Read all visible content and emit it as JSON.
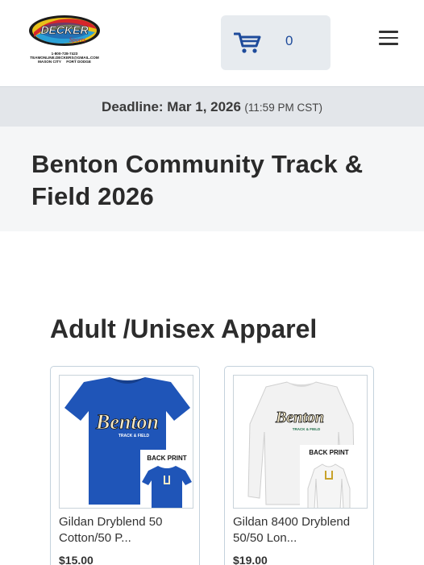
{
  "header": {
    "logo_text": "DECKER",
    "logo_script": "Sports",
    "logo_phone": "1-800-728-7423",
    "logo_email": "TEAMONLINE.DECKERS@GMAIL.COM",
    "logo_city_1": "MASON CITY",
    "logo_city_2": "FORT DODGE",
    "cart_count": "0",
    "cart_icon": "shopping-cart-icon",
    "menu_icon": "hamburger-menu-icon"
  },
  "deadline": {
    "label": "Deadline: Mar 1, 2026",
    "time": "(11:59 PM CST)"
  },
  "page": {
    "title": "Benton Community Track & Field 2026"
  },
  "sections": [
    {
      "title": "Adult /Unisex Apparel",
      "products": [
        {
          "name": "Gildan Dryblend 50 Cotton/50 P...",
          "price": "$15.00",
          "front_text": "Benton",
          "front_subtext": "TRACK & FIELD",
          "back_label": "BACK PRINT",
          "shirt_color": "#1f55b8"
        },
        {
          "name": "Gildan 8400 Dryblend 50/50 Lon...",
          "price": "$19.00",
          "front_text": "Benton",
          "front_subtext": "TRACK & FIELD",
          "back_label": "BACK PRINT",
          "shirt_color": "#f2f2f2"
        }
      ]
    }
  ],
  "colors": {
    "accent_blue": "#1e4b9b",
    "deadline_bg": "#e3e6ea",
    "title_bg": "#f5f6f7",
    "card_border": "#c4d2dc"
  }
}
